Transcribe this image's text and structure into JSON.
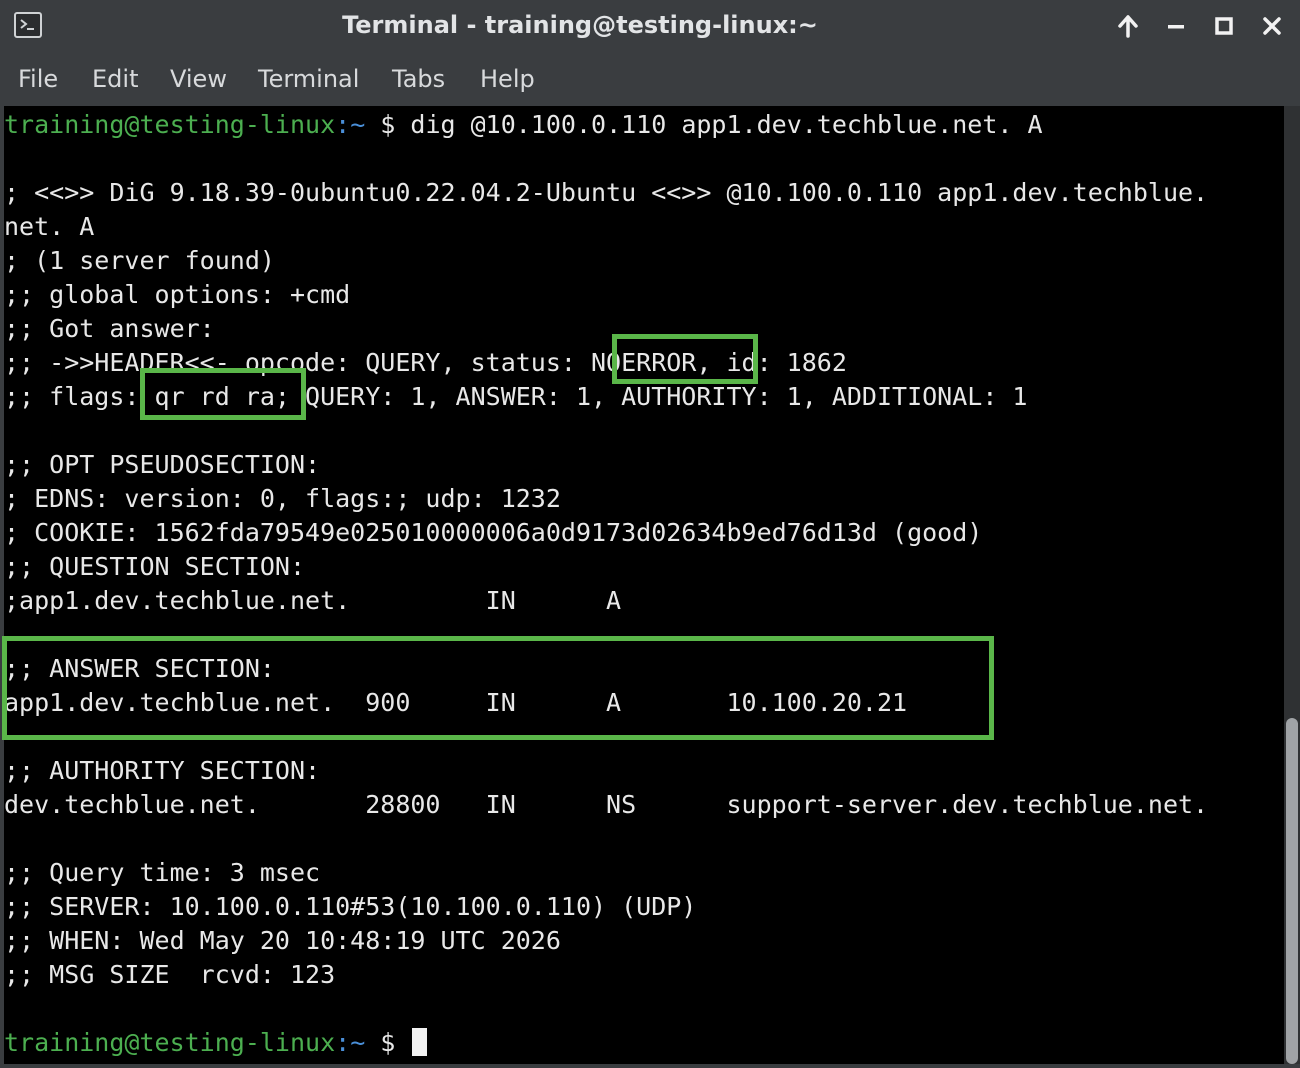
{
  "window": {
    "title": "Terminal - training@testing-linux:~"
  },
  "icons": {
    "app": "terminal-app-icon",
    "up": "arrow-up-icon",
    "minimize": "minimize-icon",
    "maximize": "maximize-icon",
    "close": "close-icon"
  },
  "menu": [
    "File",
    "Edit",
    "View",
    "Terminal",
    "Tabs",
    "Help"
  ],
  "prompt": {
    "user_host": "training@testing-linux",
    "path": ":~",
    "symbol": " $ "
  },
  "command": "dig @10.100.0.110 app1.dev.techblue.net. A",
  "output": [
    "; <<>> DiG 9.18.39-0ubuntu0.22.04.2-Ubuntu <<>> @10.100.0.110 app1.dev.techblue.",
    "net. A",
    "; (1 server found)",
    ";; global options: +cmd",
    ";; Got answer:",
    ";; ->>HEADER<<- opcode: QUERY, status: NOERROR, id: 1862",
    ";; flags: qr rd ra; QUERY: 1, ANSWER: 1, AUTHORITY: 1, ADDITIONAL: 1",
    "",
    ";; OPT PSEUDOSECTION:",
    "; EDNS: version: 0, flags:; udp: 1232",
    "; COOKIE: 1562fda79549e025010000006a0d9173d02634b9ed76d13d (good)",
    ";; QUESTION SECTION:",
    ";app1.dev.techblue.net.         IN      A",
    "",
    ";; ANSWER SECTION:",
    "app1.dev.techblue.net.  900     IN      A       10.100.20.21",
    "",
    ";; AUTHORITY SECTION:",
    "dev.techblue.net.       28800   IN      NS      support-server.dev.techblue.net.",
    "",
    ";; Query time: 3 msec",
    ";; SERVER: 10.100.0.110#53(10.100.0.110) (UDP)",
    ";; WHEN: Wed May 20 10:48:19 UTC 2026",
    ";; MSG SIZE  rcvd: 123",
    ""
  ],
  "colors": {
    "highlight": "#5ab649",
    "prompt_user": "#4caf50",
    "prompt_path": "#4a8fd8",
    "background": "#000000"
  }
}
